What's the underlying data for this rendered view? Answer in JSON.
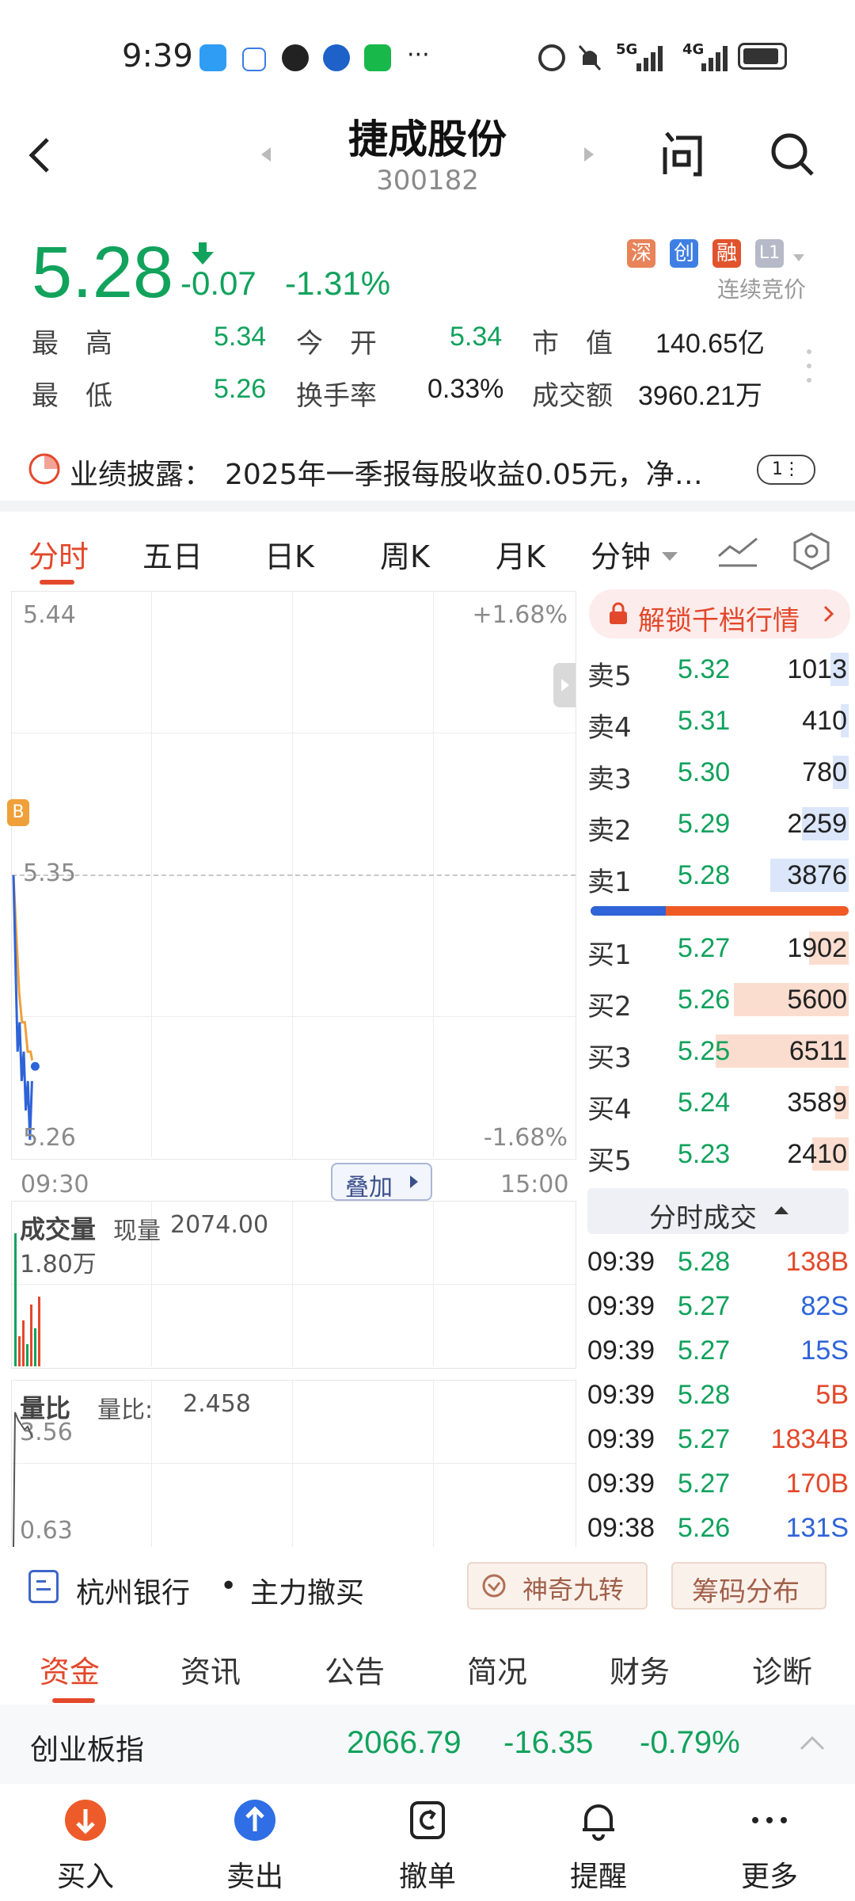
{
  "status_bar": {
    "time": "9:39",
    "more": "···",
    "network1": "5G",
    "network2": "4G"
  },
  "header": {
    "title": "捷成股份",
    "code": "300182"
  },
  "quote": {
    "price": "5.28",
    "change": "-0.07",
    "change_pct": "-1.31%",
    "tags": [
      "深",
      "创",
      "融",
      "L1"
    ],
    "trade_mode": "连续竞价",
    "stats": [
      {
        "label": "最　高",
        "value": "5.34",
        "color": "green"
      },
      {
        "label": "今　开",
        "value": "5.34",
        "color": "green"
      },
      {
        "label": "市　值",
        "value": "140.65亿",
        "color": "black"
      },
      {
        "label": "最　低",
        "value": "5.26",
        "color": "green"
      },
      {
        "label": "换手率",
        "value": "0.33%",
        "color": "black"
      },
      {
        "label": "成交额",
        "value": "3960.21万",
        "color": "black"
      }
    ]
  },
  "notice": {
    "label": "业绩披露：",
    "text": "2025年一季报每股收益0.05元，净…",
    "badge": "1⋮"
  },
  "chart_tabs": [
    "分时",
    "五日",
    "日K",
    "周K",
    "月K",
    "分钟"
  ],
  "intraday": {
    "y_max": "5.44",
    "y_mid": "5.35",
    "y_min": "5.26",
    "pct_max": "+1.68%",
    "pct_min": "-1.68%",
    "t_start": "09:30",
    "t_end": "15:00",
    "overlay_btn": "叠加",
    "marker": "B",
    "price_series": [
      5.35,
      5.32,
      5.29,
      5.3,
      5.28,
      5.29,
      5.27,
      5.28,
      5.26,
      5.28
    ],
    "avg_series": [
      5.35,
      5.33,
      5.31,
      5.3,
      5.3,
      5.29,
      5.29,
      5.285
    ]
  },
  "volume": {
    "title": "成交量",
    "label": "现量",
    "value": "2074.00",
    "max": "1.80万"
  },
  "ratio": {
    "title": "量比",
    "label": "量比:",
    "value": "2.458",
    "max": "3.56",
    "min": "0.63"
  },
  "orderbook": {
    "unlock": "解锁千档行情",
    "asks": [
      {
        "label": "卖5",
        "price": "5.32",
        "qty": "1013",
        "frac": 0.07
      },
      {
        "label": "卖4",
        "price": "5.31",
        "qty": "410",
        "frac": 0.03
      },
      {
        "label": "卖3",
        "price": "5.30",
        "qty": "780",
        "frac": 0.06
      },
      {
        "label": "卖2",
        "price": "5.29",
        "qty": "2259",
        "frac": 0.18
      },
      {
        "label": "卖1",
        "price": "5.28",
        "qty": "3876",
        "frac": 0.3
      }
    ],
    "bids": [
      {
        "label": "买1",
        "price": "5.27",
        "qty": "1902",
        "frac": 0.15
      },
      {
        "label": "买2",
        "price": "5.26",
        "qty": "5600",
        "frac": 0.44
      },
      {
        "label": "买3",
        "price": "5.25",
        "qty": "6511",
        "frac": 0.51
      },
      {
        "label": "买4",
        "price": "5.24",
        "qty": "3589",
        "frac": 0.05
      },
      {
        "label": "买5",
        "price": "5.23",
        "qty": "2410",
        "frac": 0.14
      }
    ],
    "ratio_buy": 0.29
  },
  "trades": {
    "title": "分时成交",
    "rows": [
      {
        "time": "09:39",
        "price": "5.28",
        "vol": "138B",
        "pc": "green",
        "vc": "red"
      },
      {
        "time": "09:39",
        "price": "5.27",
        "vol": "82S",
        "pc": "green",
        "vc": "blue"
      },
      {
        "time": "09:39",
        "price": "5.27",
        "vol": "15S",
        "pc": "green",
        "vc": "blue"
      },
      {
        "time": "09:39",
        "price": "5.28",
        "vol": "5B",
        "pc": "green",
        "vc": "red"
      },
      {
        "time": "09:39",
        "price": "5.27",
        "vol": "1834B",
        "pc": "green",
        "vc": "red"
      },
      {
        "time": "09:39",
        "price": "5.27",
        "vol": "170B",
        "pc": "green",
        "vc": "red"
      },
      {
        "time": "09:38",
        "price": "5.26",
        "vol": "131S",
        "pc": "green",
        "vc": "blue"
      }
    ]
  },
  "ticker_line": {
    "bank": "杭州银行",
    "event": "主力撤买",
    "btn1": "神奇九转",
    "btn2": "筹码分布"
  },
  "sub_tabs": [
    "资金",
    "资讯",
    "公告",
    "简况",
    "财务",
    "诊断"
  ],
  "index_bar": {
    "name": "创业板指",
    "value": "2066.79",
    "change": "-16.35",
    "pct": "-0.79%"
  },
  "bottom_nav": [
    {
      "label": "买入",
      "icon": "buy-icon"
    },
    {
      "label": "卖出",
      "icon": "sell-icon"
    },
    {
      "label": "撤单",
      "icon": "cancel-order-icon"
    },
    {
      "label": "提醒",
      "icon": "bell-icon"
    },
    {
      "label": "更多",
      "icon": "more-icon"
    }
  ],
  "colors": {
    "green": "#11a25c",
    "red": "#e3482b",
    "blue": "#2f64d8",
    "accent": "#e8471f"
  }
}
